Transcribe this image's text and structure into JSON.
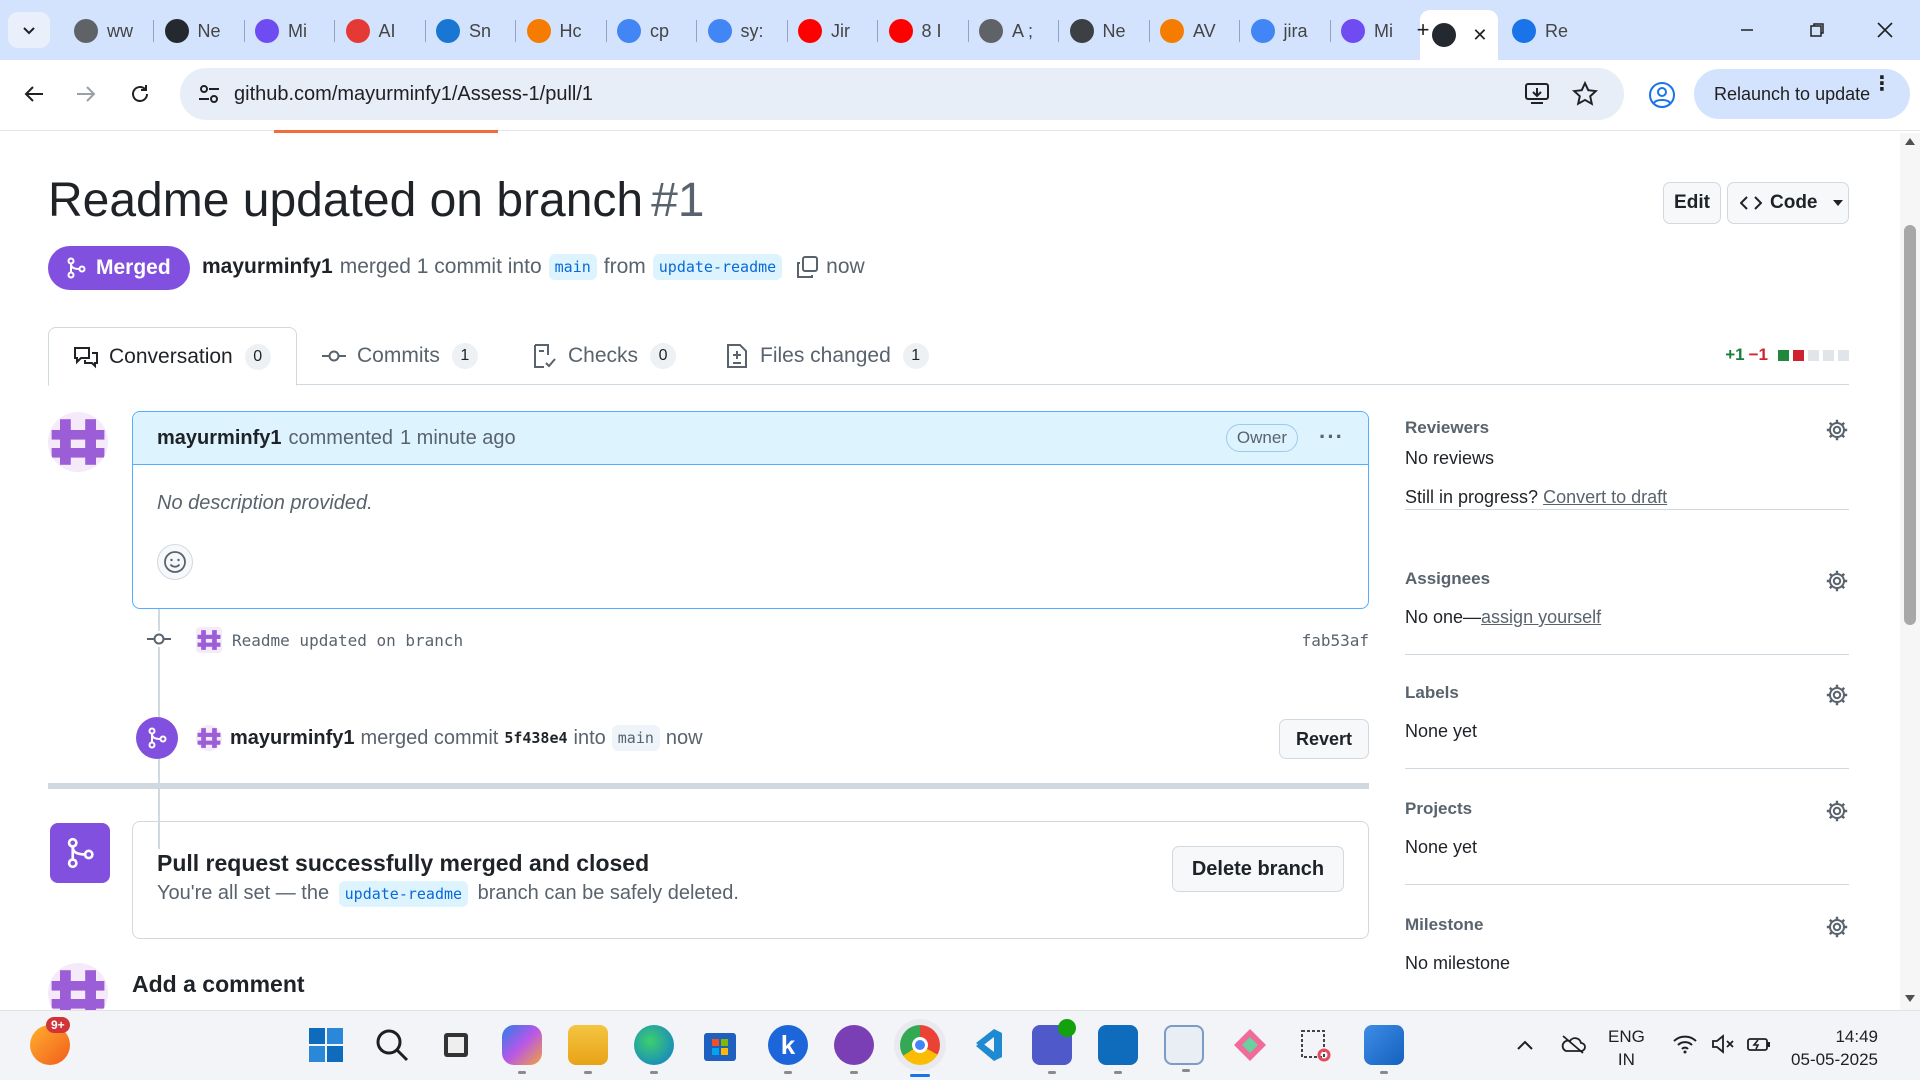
{
  "browser": {
    "tabs": [
      {
        "label": "ww",
        "color": "#5f6368"
      },
      {
        "label": "Ne",
        "color": "#24292f"
      },
      {
        "label": "Mi",
        "color": "#6f4cf2"
      },
      {
        "label": "AI",
        "color": "#e53935"
      },
      {
        "label": "Sn",
        "color": "#1976d2"
      },
      {
        "label": "Hc",
        "color": "#f57c00"
      },
      {
        "label": "cp",
        "color": "#4285f4"
      },
      {
        "label": "sy:",
        "color": "#4285f4"
      },
      {
        "label": "Jir",
        "color": "#ff0000"
      },
      {
        "label": "8 I",
        "color": "#ff0000"
      },
      {
        "label": "A ;",
        "color": "#5f6368"
      },
      {
        "label": "Ne",
        "color": "#3c4043"
      },
      {
        "label": "AV",
        "color": "#f57c00"
      },
      {
        "label": "jira",
        "color": "#4285f4"
      },
      {
        "label": "Mi",
        "color": "#6f4cf2"
      },
      {
        "label": "",
        "color": "#24292f"
      },
      {
        "label": "Re",
        "color": "#1a73e8"
      }
    ],
    "url": "github.com/mayurminfy1/Assess-1/pull/1",
    "relaunch_label": "Relaunch to update"
  },
  "pr": {
    "title": "Readme updated on branch",
    "number": "#1",
    "edit_label": "Edit",
    "code_label": "Code",
    "state_label": "Merged",
    "author": "mayurminfy1",
    "merged_text": "merged 1 commit into",
    "base_branch": "main",
    "from_text": "from",
    "head_branch": "update-readme",
    "time": "now"
  },
  "tabs": [
    {
      "label": "Conversation",
      "count": "0"
    },
    {
      "label": "Commits",
      "count": "1"
    },
    {
      "label": "Checks",
      "count": "0"
    },
    {
      "label": "Files changed",
      "count": "1"
    }
  ],
  "diffstat": {
    "added": "+1",
    "removed": "−1"
  },
  "comment": {
    "author": "mayurminfy1",
    "action": "commented",
    "time": "1 minute ago",
    "role": "Owner",
    "body": "No description provided."
  },
  "commit": {
    "message": "Readme updated on branch",
    "sha": "fab53af"
  },
  "merge_event": {
    "author": "mayurminfy1",
    "action": "merged commit",
    "sha": "5f438e4",
    "into": "into",
    "branch": "main",
    "time": "now",
    "revert_label": "Revert"
  },
  "merged_box": {
    "title": "Pull request successfully merged and closed",
    "sub_before": "You're all set — the",
    "branch": "update-readme",
    "sub_after": "branch can be safely deleted.",
    "delete_label": "Delete branch"
  },
  "add_comment_label": "Add a comment",
  "sidebar": {
    "reviewers": {
      "title": "Reviewers",
      "value": "No reviews",
      "prompt": "Still in progress?",
      "link": "Convert to draft"
    },
    "assignees": {
      "title": "Assignees",
      "value": "No one—",
      "link": "assign yourself"
    },
    "labels": {
      "title": "Labels",
      "value": "None yet"
    },
    "projects": {
      "title": "Projects",
      "value": "None yet"
    },
    "milestone": {
      "title": "Milestone",
      "value": "No milestone"
    }
  },
  "taskbar": {
    "badge": "9+",
    "lang_line1": "ENG",
    "lang_line2": "IN",
    "time": "14:49",
    "date": "05-05-2025"
  }
}
